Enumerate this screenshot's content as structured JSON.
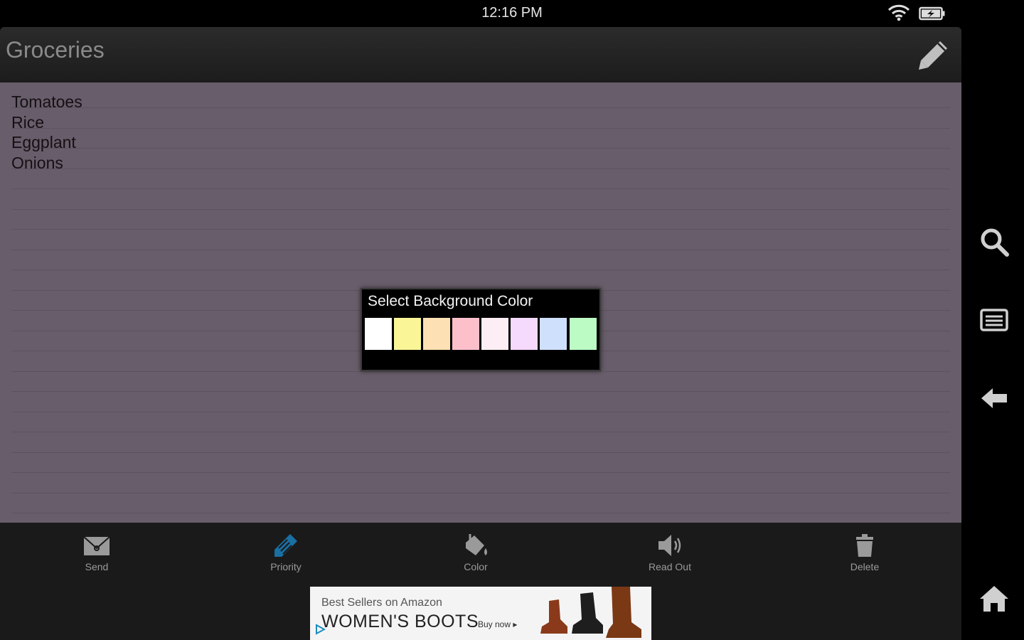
{
  "status_bar": {
    "time": "12:16 PM",
    "icons": [
      "wifi-icon",
      "battery-charging-icon"
    ]
  },
  "header": {
    "title": "Groceries",
    "edit_icon": "pencil-icon"
  },
  "note": {
    "background_color": "#685d6a",
    "lines": [
      "Tomatoes",
      "Rice",
      "Eggplant",
      "Onions"
    ]
  },
  "color_dialog": {
    "title": "Select Background Color",
    "swatches": [
      {
        "name": "white",
        "color": "#ffffff"
      },
      {
        "name": "yellow",
        "color": "#faf697"
      },
      {
        "name": "peach",
        "color": "#fde0b4"
      },
      {
        "name": "pink",
        "color": "#fdc0cb"
      },
      {
        "name": "light-pink",
        "color": "#fdeef5"
      },
      {
        "name": "lavender",
        "color": "#f6dafd"
      },
      {
        "name": "light-blue",
        "color": "#cfe0fd"
      },
      {
        "name": "mint",
        "color": "#bdfbc4"
      }
    ]
  },
  "toolbar": {
    "send_label": "Send",
    "priority_label": "Priority",
    "color_label": "Color",
    "read_out_label": "Read Out",
    "delete_label": "Delete",
    "accent_color": "#1a6fa3"
  },
  "ad": {
    "line1": "Best Sellers on Amazon",
    "line2": "WOMEN'S BOOTS",
    "cta": "Buy now ▸"
  },
  "system_bar": {
    "icons": [
      "search-icon",
      "menu-icon",
      "back-icon",
      "home-icon"
    ]
  }
}
